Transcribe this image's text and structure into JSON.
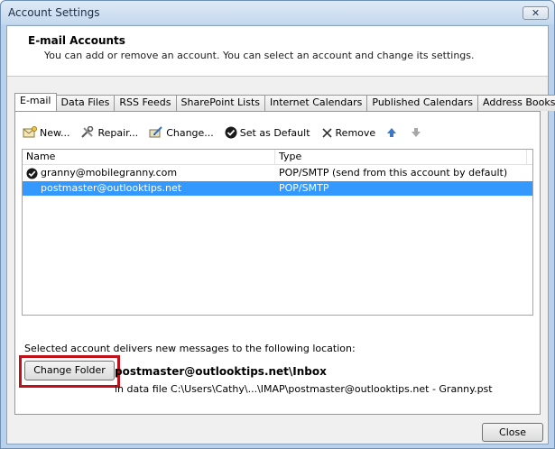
{
  "window": {
    "title": "Account Settings",
    "close_glyph": "✕"
  },
  "header": {
    "title": "E-mail Accounts",
    "subtitle": "You can add or remove an account. You can select an account and change its settings."
  },
  "tabs": [
    {
      "label": "E-mail",
      "active": true
    },
    {
      "label": "Data Files"
    },
    {
      "label": "RSS Feeds"
    },
    {
      "label": "SharePoint Lists"
    },
    {
      "label": "Internet Calendars"
    },
    {
      "label": "Published Calendars"
    },
    {
      "label": "Address Books"
    }
  ],
  "toolbar": {
    "new_label": "New...",
    "repair_label": "Repair...",
    "change_label": "Change...",
    "default_label": "Set as Default",
    "remove_label": "Remove"
  },
  "list": {
    "col_name": "Name",
    "col_type": "Type",
    "rows": [
      {
        "name": "granny@mobilegranny.com",
        "type": "POP/SMTP (send from this account by default)",
        "is_default": true
      },
      {
        "name": "postmaster@outlooktips.net",
        "type": "POP/SMTP",
        "selected": true
      }
    ]
  },
  "delivery": {
    "intro": "Selected account delivers new messages to the following location:",
    "button_label": "Change Folder",
    "folder_path": "postmaster@outlooktips.net\\Inbox",
    "datafile": "in data file C:\\Users\\Cathy\\...\\IMAP\\postmaster@outlooktips.net - Granny.pst"
  },
  "footer": {
    "close_label": "Close"
  },
  "colors": {
    "selection": "#3399ff",
    "highlight": "#c0101a"
  }
}
